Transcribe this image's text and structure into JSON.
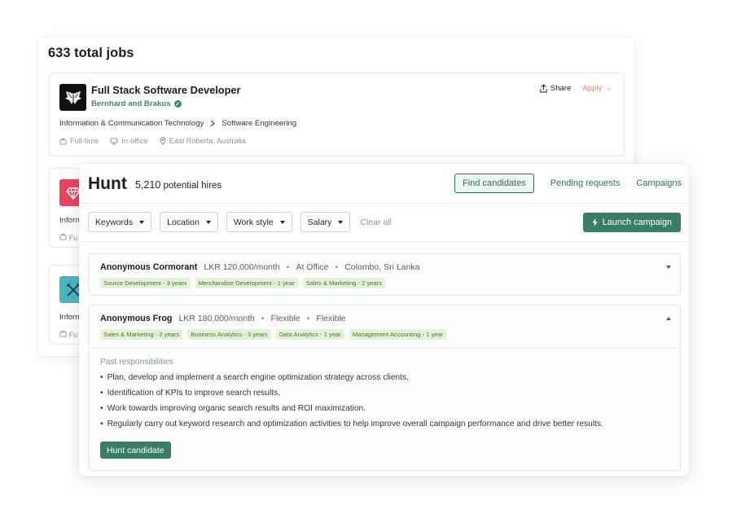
{
  "jobs": {
    "total_label": "633 total jobs",
    "featured": {
      "title": "Full Stack Software Developer",
      "company": "Bernhard and Brakus",
      "share_label": "Share",
      "apply_label": "Apply",
      "category": "Information & Communication Technology",
      "subcategory": "Software Engineering",
      "employment_type": "Full-time",
      "work_mode": "In-office",
      "location": "East Roberta, Australia"
    },
    "stubs": [
      {
        "category_partial": "Inform",
        "meta_partial": "Fu"
      },
      {
        "category_partial": "Inform",
        "meta_partial": "Fu"
      }
    ]
  },
  "hunt": {
    "title": "Hunt",
    "count": "5,210",
    "count_label": "potential hires",
    "nav": {
      "find": "Find candidates",
      "pending": "Pending requests",
      "campaigns": "Campaigns"
    },
    "filters": [
      "Keywords",
      "Location",
      "Work style",
      "Salary"
    ],
    "clear_label": "Clear all",
    "launch_label": "Launch campaign",
    "candidates": [
      {
        "name": "Anonymous Cormorant",
        "salary": "LKR 120,000/month",
        "work_style": "At Office",
        "location": "Colombo, Sri Lanka",
        "tags": [
          "Source Development - 3 years",
          "Merchandise Development - 1 year",
          "Sales & Marketing - 2 years"
        ]
      },
      {
        "name": "Anonymous Frog",
        "salary": "LKR 180,000/month",
        "work_style": "Flexible",
        "location": "Flexible",
        "tags": [
          "Sales & Marketing - 2 years",
          "Business Analytics - 3 years",
          "Data Analytics - 1 year",
          "Management Accounting - 1 year"
        ],
        "responsibilities_title": "Past responsibilities",
        "responsibilities": [
          "Plan, develop and implement a search engine optimization strategy across clients.",
          "Identification of KPIs to improve search results.",
          "Work towards improving organic search results and ROI maximization.",
          "Regularly carry out keyword research and optimization activities to help improve overall campaign performance and drive better results."
        ],
        "action_label": "Hunt candidate"
      }
    ]
  },
  "colors": {
    "brand_green": "#3a7d66",
    "apply_orange": "#e8845d",
    "tag_bg": "#e4f2d9",
    "tag_text": "#3f7a2b"
  },
  "icons": {
    "share": "share-icon",
    "apply": "arrow-right-icon",
    "verified": "verified-check-icon",
    "briefcase": "briefcase-icon",
    "monitor": "monitor-icon",
    "location": "location-pin-icon",
    "bolt": "bolt-icon",
    "caret": "caret-down-icon"
  }
}
